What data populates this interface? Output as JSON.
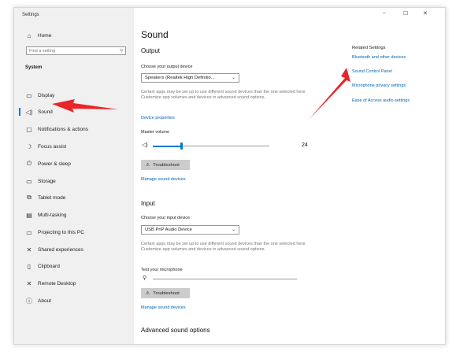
{
  "window": {
    "title": "Settings"
  },
  "titlebar": {
    "minimize": "–",
    "maximize": "☐",
    "close": "✕"
  },
  "sidebar": {
    "home": "Home",
    "search_placeholder": "Find a setting",
    "section": "System",
    "items": [
      {
        "label": "Display",
        "icon": "display-icon",
        "glyph": "▭"
      },
      {
        "label": "Sound",
        "icon": "speaker-icon",
        "glyph": "◁)"
      },
      {
        "label": "Notifications & actions",
        "icon": "notification-icon",
        "glyph": "▢"
      },
      {
        "label": "Focus assist",
        "icon": "moon-icon",
        "glyph": "☽"
      },
      {
        "label": "Power & sleep",
        "icon": "power-icon",
        "glyph": "⏻"
      },
      {
        "label": "Storage",
        "icon": "storage-icon",
        "glyph": "▭"
      },
      {
        "label": "Tablet mode",
        "icon": "tablet-icon",
        "glyph": "⧉"
      },
      {
        "label": "Multi-tasking",
        "icon": "multitask-icon",
        "glyph": "▤"
      },
      {
        "label": "Projecting to this PC",
        "icon": "project-icon",
        "glyph": "▭"
      },
      {
        "label": "Shared experiences",
        "icon": "shared-icon",
        "glyph": "✕"
      },
      {
        "label": "Clipboard",
        "icon": "clipboard-icon",
        "glyph": "▯"
      },
      {
        "label": "Remote Desktop",
        "icon": "remote-icon",
        "glyph": "✕"
      },
      {
        "label": "About",
        "icon": "info-icon",
        "glyph": "ⓘ"
      }
    ],
    "active": "Sound"
  },
  "main": {
    "title": "Sound",
    "output": {
      "heading": "Output",
      "choose_label": "Choose your output device",
      "device": "Speakers (Realtek High Definitio...",
      "description": "Certain apps may be set up to use different sound devices than the one selected here. Customize app volumes and devices in advanced sound options.",
      "device_properties": "Device properties",
      "master_volume_label": "Master volume",
      "master_volume_value": "24",
      "troubleshoot": "Troubleshoot",
      "manage": "Manage sound devices"
    },
    "input": {
      "heading": "Input",
      "choose_label": "Choose your input device",
      "device": "USB PnP Audio Device",
      "description": "Certain apps may be set up to use different sound devices than the one selected here. Customize app volumes and devices in advanced sound options.",
      "test_label": "Test your microphone",
      "troubleshoot": "Troubleshoot",
      "manage": "Manage sound devices"
    },
    "advanced": "Advanced sound options",
    "related": {
      "label": "Related Settings",
      "links": [
        "Bluetooth and other devices",
        "Sound Control Panel",
        "Microphone privacy settings",
        "Ease of Access audio settings"
      ]
    }
  },
  "colors": {
    "accent": "#0078d7",
    "link": "#0063b1",
    "annotation_arrow": "#e8262a"
  }
}
